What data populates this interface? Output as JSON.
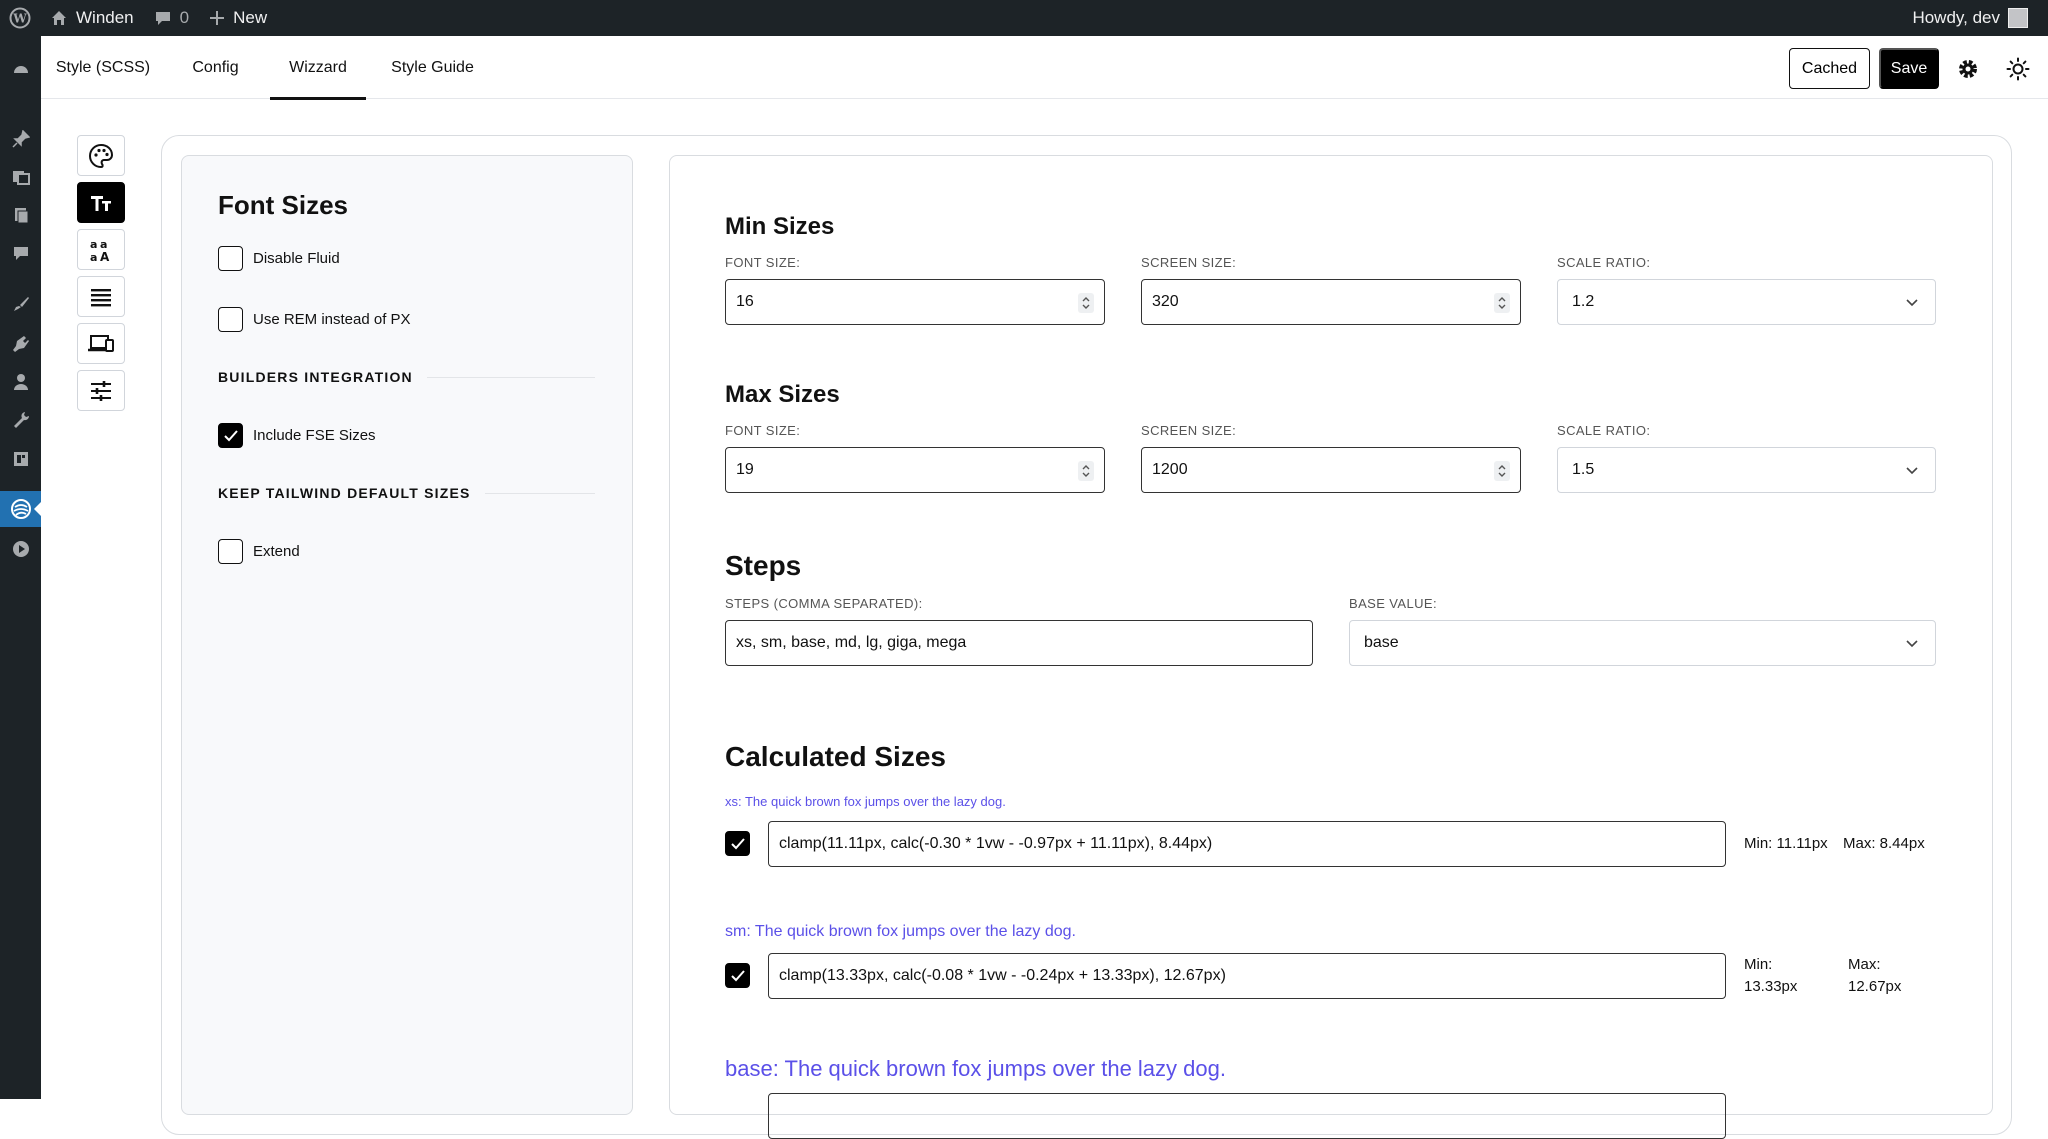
{
  "adminbar": {
    "site_name": "Winden",
    "comments_count": "0",
    "new_label": "New",
    "howdy": "Howdy, dev"
  },
  "tabs": [
    {
      "label": "Style (SCSS)"
    },
    {
      "label": "Config"
    },
    {
      "label": "Wizzard",
      "active": true
    },
    {
      "label": "Style Guide"
    }
  ],
  "toolbar": {
    "cached_label": "Cached",
    "save_label": "Save"
  },
  "left_panel": {
    "title": "Font Sizes",
    "disable_fluid": {
      "label": "Disable Fluid",
      "checked": false
    },
    "use_rem": {
      "label": "Use REM instead of PX",
      "checked": false
    },
    "builders_heading": "BUILDERS INTEGRATION",
    "include_fse": {
      "label": "Include FSE Sizes",
      "checked": true
    },
    "tailwind_heading": "KEEP TAILWIND DEFAULT SIZES",
    "extend": {
      "label": "Extend",
      "checked": false
    }
  },
  "min_sizes": {
    "title": "Min Sizes",
    "font_size_label": "FONT SIZE:",
    "font_size": "16",
    "screen_size_label": "SCREEN SIZE:",
    "screen_size": "320",
    "scale_ratio_label": "SCALE RATIO:",
    "scale_ratio": "1.2"
  },
  "max_sizes": {
    "title": "Max Sizes",
    "font_size_label": "FONT SIZE:",
    "font_size": "19",
    "screen_size_label": "SCREEN SIZE:",
    "screen_size": "1200",
    "scale_ratio_label": "SCALE RATIO:",
    "scale_ratio": "1.5"
  },
  "steps": {
    "title": "Steps",
    "steps_label": "STEPS (COMMA SEPARATED):",
    "steps_value": "xs, sm, base, md, lg, giga, mega",
    "base_label": "BASE VALUE:",
    "base_value": "base"
  },
  "calculated": {
    "title": "Calculated Sizes",
    "rows": [
      {
        "sample": "xs: The quick brown fox jumps over the lazy dog.",
        "checked": true,
        "value": "clamp(11.11px, calc(-0.30 * 1vw - -0.97px + 11.11px), 8.44px)",
        "min": "Min: 11.11px",
        "max": "Max: 8.44px"
      },
      {
        "sample": "sm: The quick brown fox jumps over the lazy dog.",
        "checked": true,
        "value": "clamp(13.33px, calc(-0.08 * 1vw - -0.24px + 13.33px), 12.67px)",
        "min_label": "Min:",
        "min_value": "13.33px",
        "max_label": "Max:",
        "max_value": "12.67px"
      },
      {
        "sample": "base: The quick brown fox jumps over the lazy dog."
      }
    ]
  }
}
